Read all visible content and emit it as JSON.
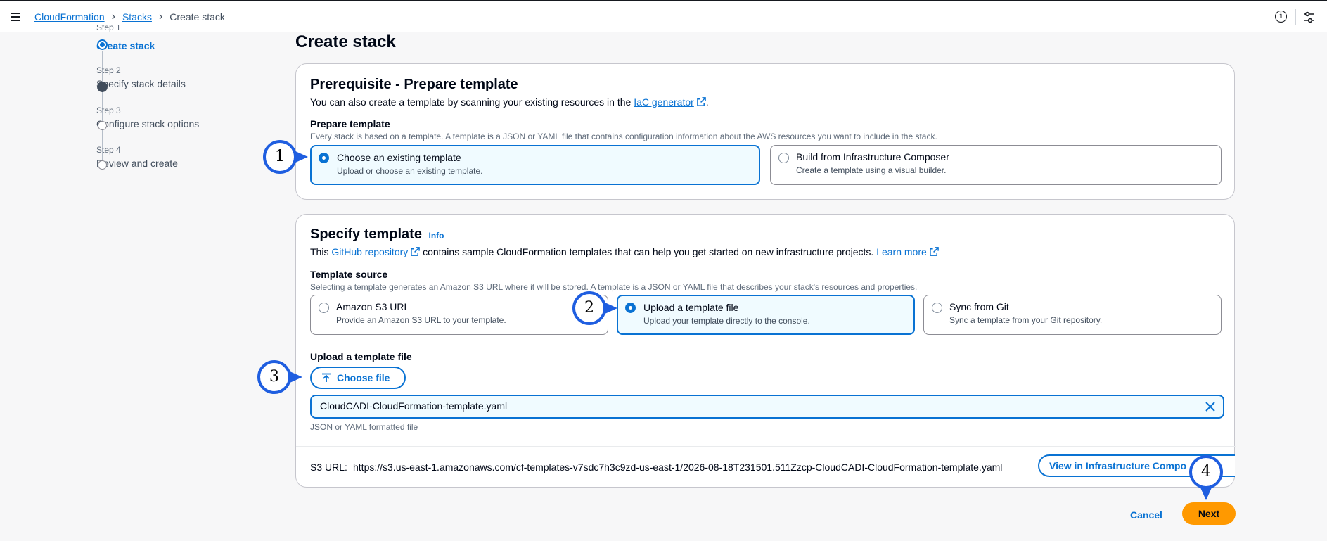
{
  "breadcrumb": {
    "root": "CloudFormation",
    "stacks": "Stacks",
    "current": "Create stack"
  },
  "steps": [
    {
      "small": "Step 1",
      "title": "Create stack",
      "state": "current"
    },
    {
      "small": "Step 2",
      "title": "Specify stack details",
      "state": "filled"
    },
    {
      "small": "Step 3",
      "title": "Configure stack options",
      "state": "empty"
    },
    {
      "small": "Step 4",
      "title": "Review and create",
      "state": "empty"
    }
  ],
  "page_title": "Create stack",
  "prereq": {
    "title": "Prerequisite - Prepare template",
    "desc_prefix": "You can also create a template by scanning your existing resources in the",
    "desc_link": "IaC generator",
    "desc_suffix": ".",
    "label": "Prepare template",
    "help": "Every stack is based on a template. A template is a JSON or YAML file that contains configuration information about the AWS resources you want to include in the stack.",
    "options": [
      {
        "title": "Choose an existing template",
        "desc": "Upload or choose an existing template.",
        "selected": true
      },
      {
        "title": "Build from Infrastructure Composer",
        "desc": "Create a template using a visual builder.",
        "selected": false
      }
    ]
  },
  "specify": {
    "title": "Specify template",
    "info": "Info",
    "desc_prefix": "This",
    "desc_link1": "GitHub repository",
    "desc_middle": "contains sample CloudFormation templates that can help you get started on new infrastructure projects.",
    "desc_link2": "Learn more",
    "source_label": "Template source",
    "source_help": "Selecting a template generates an Amazon S3 URL where it will be stored. A template is a JSON or YAML file that describes your stack's resources and properties.",
    "sources": [
      {
        "title": "Amazon S3 URL",
        "desc": "Provide an Amazon S3 URL to your template.",
        "selected": false
      },
      {
        "title": "Upload a template file",
        "desc": "Upload your template directly to the console.",
        "selected": true
      },
      {
        "title": "Sync from Git",
        "desc": "Sync a template from your Git repository.",
        "selected": false
      }
    ],
    "upload_label": "Upload a template file",
    "choose_file": "Choose file",
    "file_name": "CloudCADI-CloudFormation-template.yaml",
    "file_help": "JSON or YAML formatted file",
    "s3_label": "S3 URL:",
    "s3_url": "https://s3.us-east-1.amazonaws.com/cf-templates-v7sdc7h3c9zd-us-east-1/2026-08-18T231501.511Zzcp-CloudCADI-CloudFormation-template.yaml",
    "view_button": "View in Infrastructure Compo"
  },
  "footer": {
    "cancel": "Cancel",
    "next": "Next"
  },
  "callouts": [
    "1",
    "2",
    "3",
    "4"
  ],
  "colors": {
    "accent": "#0972d3",
    "primary_button": "#ff9900",
    "callout_ring": "#1f5ee0"
  },
  "icons": [
    "menu-icon",
    "info-circle-icon",
    "settings-icon",
    "external-link-icon",
    "upload-icon",
    "clear-icon"
  ]
}
